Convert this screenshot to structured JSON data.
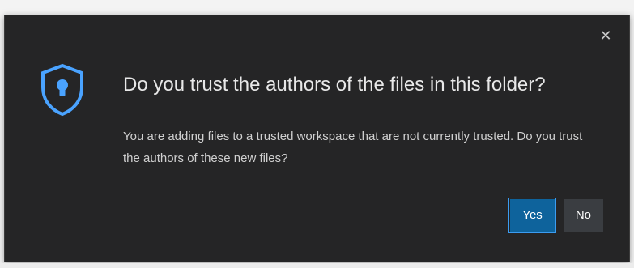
{
  "dialog": {
    "title": "Do you trust the authors of the files in this folder?",
    "message": "You are adding files to a trusted workspace that are not currently trusted. Do you trust the authors of these new files?",
    "close_icon": "close-icon",
    "shield_icon": "shield-icon",
    "buttons": {
      "yes_label": "Yes",
      "no_label": "No"
    }
  },
  "colors": {
    "dialog_background": "#252526",
    "accent": "#4aa3ff",
    "primary_button": "#0e639c",
    "secondary_button": "#3a3d41",
    "text": "#e8e8e8"
  }
}
